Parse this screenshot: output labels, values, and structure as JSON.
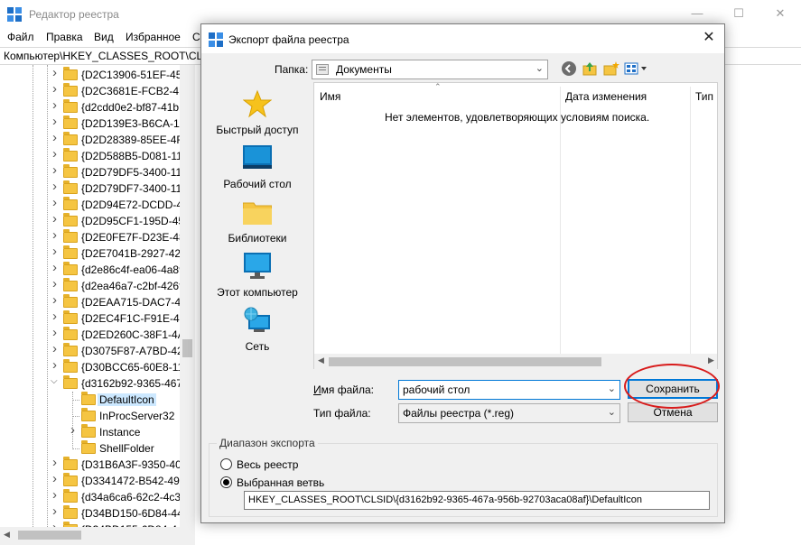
{
  "regedit": {
    "title": "Редактор реестра",
    "menu": [
      "Файл",
      "Правка",
      "Вид",
      "Избранное",
      "С"
    ],
    "address": "Компьютер\\HKEY_CLASSES_ROOT\\CLSID\\",
    "tree": [
      {
        "label": "{D2C13906-51EF-454",
        "expanded": false
      },
      {
        "label": "{D2C3681E-FCB2-4D",
        "expanded": false
      },
      {
        "label": "{d2cdd0e2-bf87-41b",
        "expanded": false
      },
      {
        "label": "{D2D139E3-B6CA-11",
        "expanded": false
      },
      {
        "label": "{D2D28389-85EE-4F9",
        "expanded": false
      },
      {
        "label": "{D2D588B5-D081-11I",
        "expanded": false
      },
      {
        "label": "{D2D79DF5-3400-11c",
        "expanded": false
      },
      {
        "label": "{D2D79DF7-3400-11c",
        "expanded": false
      },
      {
        "label": "{D2D94E72-DCDD-42",
        "expanded": false
      },
      {
        "label": "{D2D95CF1-195D-45",
        "expanded": false
      },
      {
        "label": "{D2E0FE7F-D23E-48E",
        "expanded": false
      },
      {
        "label": "{D2E7041B-2927-42fl",
        "expanded": false
      },
      {
        "label": "{d2e86c4f-ea06-4a89",
        "expanded": false
      },
      {
        "label": "{d2ea46a7-c2bf-426t",
        "expanded": false
      },
      {
        "label": "{D2EAA715-DAC7-47",
        "expanded": false
      },
      {
        "label": "{D2EC4F1C-F91E-4F5",
        "expanded": false
      },
      {
        "label": "{D2ED260C-38F1-4A",
        "expanded": false
      },
      {
        "label": "{D3075F87-A7BD-42",
        "expanded": false
      },
      {
        "label": "{D30BCC65-60E8-11I",
        "expanded": false
      },
      {
        "label": "{d3162b92-9365-467",
        "expanded": true
      }
    ],
    "children": [
      {
        "label": "DefaultIcon",
        "selected": true,
        "has_children": false
      },
      {
        "label": "InProcServer32",
        "selected": false,
        "has_children": false
      },
      {
        "label": "Instance",
        "selected": false,
        "has_children": true
      },
      {
        "label": "ShellFolder",
        "selected": false,
        "has_children": false
      }
    ],
    "tree_after": [
      {
        "label": "{D31B6A3F-9350-40E"
      },
      {
        "label": "{D3341472-B542-498"
      },
      {
        "label": "{d34a6ca6-62c2-4c34"
      },
      {
        "label": "{D34BD150-6D84-44"
      },
      {
        "label": "{D34BD155-6D84-44"
      }
    ]
  },
  "dialog": {
    "title": "Экспорт файла реестра",
    "folder_label": "Папка:",
    "folder_value": "Документы",
    "places": [
      {
        "label": "Быстрый доступ",
        "icon": "star-icon"
      },
      {
        "label": "Рабочий стол",
        "icon": "desktop-icon"
      },
      {
        "label": "Библиотеки",
        "icon": "libraries-folder-icon"
      },
      {
        "label": "Этот компьютер",
        "icon": "computer-icon"
      },
      {
        "label": "Сеть",
        "icon": "network-icon"
      }
    ],
    "columns": [
      "Имя",
      "Дата изменения",
      "Тип"
    ],
    "empty_message": "Нет элементов, удовлетворяющих условиям поиска.",
    "filename_label": "Имя файла:",
    "filename_value": "рабочий стол",
    "filetype_label": "Тип файла:",
    "filetype_value": "Файлы реестра (*.reg)",
    "save_label": "Сохранить",
    "cancel_label": "Отмена",
    "range_legend": "Диапазон экспорта",
    "radio_all": "Весь реестр",
    "radio_branch": "Выбранная ветвь",
    "selected_radio": "branch",
    "branch_path": "HKEY_CLASSES_ROOT\\CLSID\\{d3162b92-9365-467a-956b-92703aca08af}\\DefaultIcon",
    "highlight_color": "#d81b1b",
    "accent_color": "#0078d7"
  }
}
